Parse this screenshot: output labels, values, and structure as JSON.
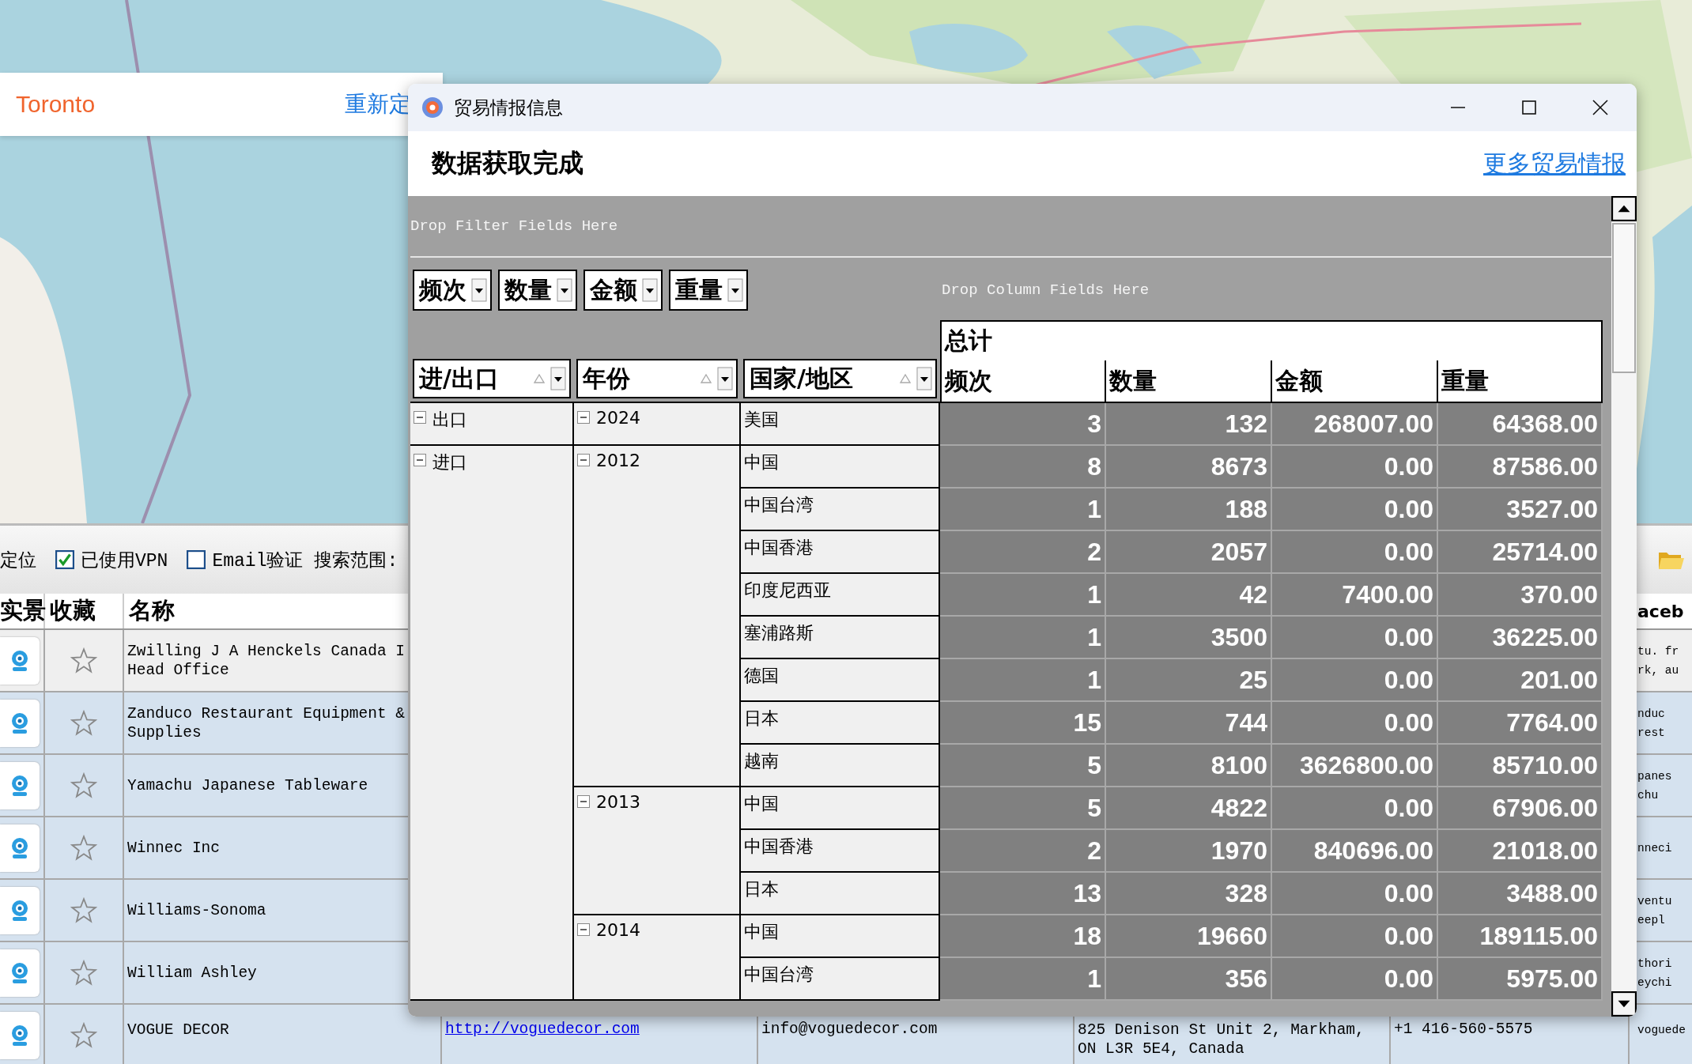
{
  "map_card": {
    "city": "Toronto",
    "relocate_link": "重新定"
  },
  "toolbar": {
    "label": "定位",
    "checkboxes": [
      {
        "label": "已使用VPN",
        "checked": true
      },
      {
        "label": "Email验证",
        "checked": false
      }
    ],
    "search_scope_label": "搜索范围:"
  },
  "results_table": {
    "columns": [
      "实景",
      "收藏",
      "名称"
    ],
    "column_9": "aceb",
    "rows": [
      {
        "highlighted": false,
        "favorite": false,
        "name_lines": [
          "Zwilling J A Henckels Canada I",
          "Head Office"
        ],
        "column_9_lines": [
          "tu. fr",
          "rk, au"
        ]
      },
      {
        "highlighted": true,
        "favorite": false,
        "name_lines": [
          "Zanduco Restaurant Equipment &",
          "Supplies"
        ],
        "column_9_lines": [
          "nduc",
          "rest"
        ]
      },
      {
        "highlighted": true,
        "favorite": false,
        "name_lines": [
          "Yamachu Japanese Tableware"
        ],
        "column_9_lines": [
          "panes",
          "chu"
        ]
      },
      {
        "highlighted": true,
        "favorite": false,
        "name_lines": [
          "Winnec Inc"
        ],
        "column_9_lines": [
          "nneci"
        ]
      },
      {
        "highlighted": true,
        "favorite": false,
        "name_lines": [
          "Williams-Sonoma"
        ],
        "column_9_lines": [
          "ventu",
          "eepl"
        ]
      },
      {
        "highlighted": true,
        "favorite": false,
        "name_lines": [
          "William Ashley"
        ],
        "column_9_lines": [
          "thori",
          "eychi"
        ]
      },
      {
        "highlighted": true,
        "favorite": false,
        "name_lines": [
          "VOGUE DECOR"
        ],
        "website": "http://voguedecor.com",
        "email": "info@voguedecor.com",
        "address_lines": [
          "825 Denison St Unit 2, Markham,",
          "ON L3R 5E4, Canada"
        ],
        "phone": "+1 416-560-5575",
        "column_9_lines": [
          "voguede"
        ]
      }
    ]
  },
  "dialog": {
    "title": "贸易情报信息",
    "status": "数据获取完成",
    "more_link": "更多贸易情报",
    "pivot": {
      "filter_zone": "Drop Filter Fields Here",
      "column_zone": "Drop Column Fields Here",
      "data_fields": [
        "频次",
        "数量",
        "金额",
        "重量"
      ],
      "row_fields": [
        "进/出口",
        "年份",
        "国家/地区"
      ],
      "total_header": "总计",
      "value_headers": [
        "频次",
        "数量",
        "金额",
        "重量"
      ],
      "rows": [
        {
          "label": "出口",
          "expanded": true,
          "children": [
            {
              "label": "2024",
              "expanded": true,
              "children": [
                {
                  "label": "美国",
                  "values": [
                    "3",
                    "132",
                    "268007.00",
                    "64368.00"
                  ]
                }
              ]
            }
          ]
        },
        {
          "label": "进口",
          "expanded": true,
          "children": [
            {
              "label": "2012",
              "expanded": true,
              "children": [
                {
                  "label": "中国",
                  "values": [
                    "8",
                    "8673",
                    "0.00",
                    "87586.00"
                  ]
                },
                {
                  "label": "中国台湾",
                  "values": [
                    "1",
                    "188",
                    "0.00",
                    "3527.00"
                  ]
                },
                {
                  "label": "中国香港",
                  "values": [
                    "2",
                    "2057",
                    "0.00",
                    "25714.00"
                  ]
                },
                {
                  "label": "印度尼西亚",
                  "values": [
                    "1",
                    "42",
                    "7400.00",
                    "370.00"
                  ]
                },
                {
                  "label": "塞浦路斯",
                  "values": [
                    "1",
                    "3500",
                    "0.00",
                    "36225.00"
                  ]
                },
                {
                  "label": "德国",
                  "values": [
                    "1",
                    "25",
                    "0.00",
                    "201.00"
                  ]
                },
                {
                  "label": "日本",
                  "values": [
                    "15",
                    "744",
                    "0.00",
                    "7764.00"
                  ]
                },
                {
                  "label": "越南",
                  "values": [
                    "5",
                    "8100",
                    "3626800.00",
                    "85710.00"
                  ]
                }
              ]
            },
            {
              "label": "2013",
              "expanded": true,
              "children": [
                {
                  "label": "中国",
                  "values": [
                    "5",
                    "4822",
                    "0.00",
                    "67906.00"
                  ]
                },
                {
                  "label": "中国香港",
                  "values": [
                    "2",
                    "1970",
                    "840696.00",
                    "21018.00"
                  ]
                },
                {
                  "label": "日本",
                  "values": [
                    "13",
                    "328",
                    "0.00",
                    "3488.00"
                  ]
                }
              ]
            },
            {
              "label": "2014",
              "expanded": true,
              "children": [
                {
                  "label": "中国",
                  "values": [
                    "18",
                    "19660",
                    "0.00",
                    "189115.00"
                  ]
                },
                {
                  "label": "中国台湾",
                  "values": [
                    "1",
                    "356",
                    "0.00",
                    "5975.00"
                  ]
                }
              ]
            }
          ]
        }
      ]
    }
  }
}
